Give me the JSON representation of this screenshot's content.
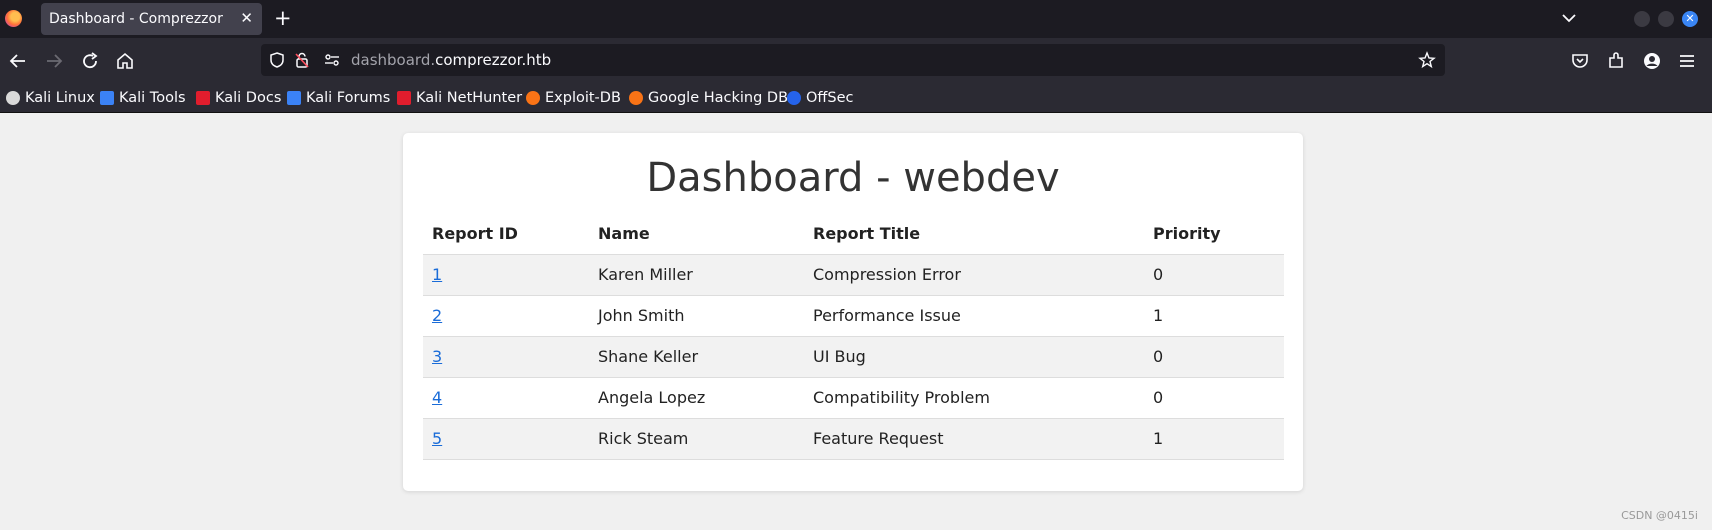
{
  "browser": {
    "tab": {
      "title": "Dashboard - Comprezzor",
      "close": "✕"
    },
    "new_tab": "+",
    "url": {
      "subdomain": "dashboard.",
      "domain": "comprezzor.htb"
    },
    "bookmarks": [
      {
        "label": "Kali Linux",
        "color": "#d9d9d9"
      },
      {
        "label": "Kali Tools",
        "color": "#3b82f6"
      },
      {
        "label": "Kali Docs",
        "color": "#e11d2d"
      },
      {
        "label": "Kali Forums",
        "color": "#3b82f6"
      },
      {
        "label": "Kali NetHunter",
        "color": "#e11d2d"
      },
      {
        "label": "Exploit-DB",
        "color": "#f97316"
      },
      {
        "label": "Google Hacking DB",
        "color": "#f97316"
      },
      {
        "label": "OffSec",
        "color": "#2563eb"
      }
    ]
  },
  "page": {
    "title": "Dashboard - webdev",
    "columns": [
      "Report ID",
      "Name",
      "Report Title",
      "Priority"
    ],
    "rows": [
      {
        "id": "1",
        "name": "Karen Miller",
        "title": "Compression Error",
        "priority": "0"
      },
      {
        "id": "2",
        "name": "John Smith",
        "title": "Performance Issue",
        "priority": "1"
      },
      {
        "id": "3",
        "name": "Shane Keller",
        "title": "UI Bug",
        "priority": "0"
      },
      {
        "id": "4",
        "name": "Angela Lopez",
        "title": "Compatibility Problem",
        "priority": "0"
      },
      {
        "id": "5",
        "name": "Rick Steam",
        "title": "Feature Request",
        "priority": "1"
      }
    ]
  },
  "watermark": "CSDN @0415i"
}
